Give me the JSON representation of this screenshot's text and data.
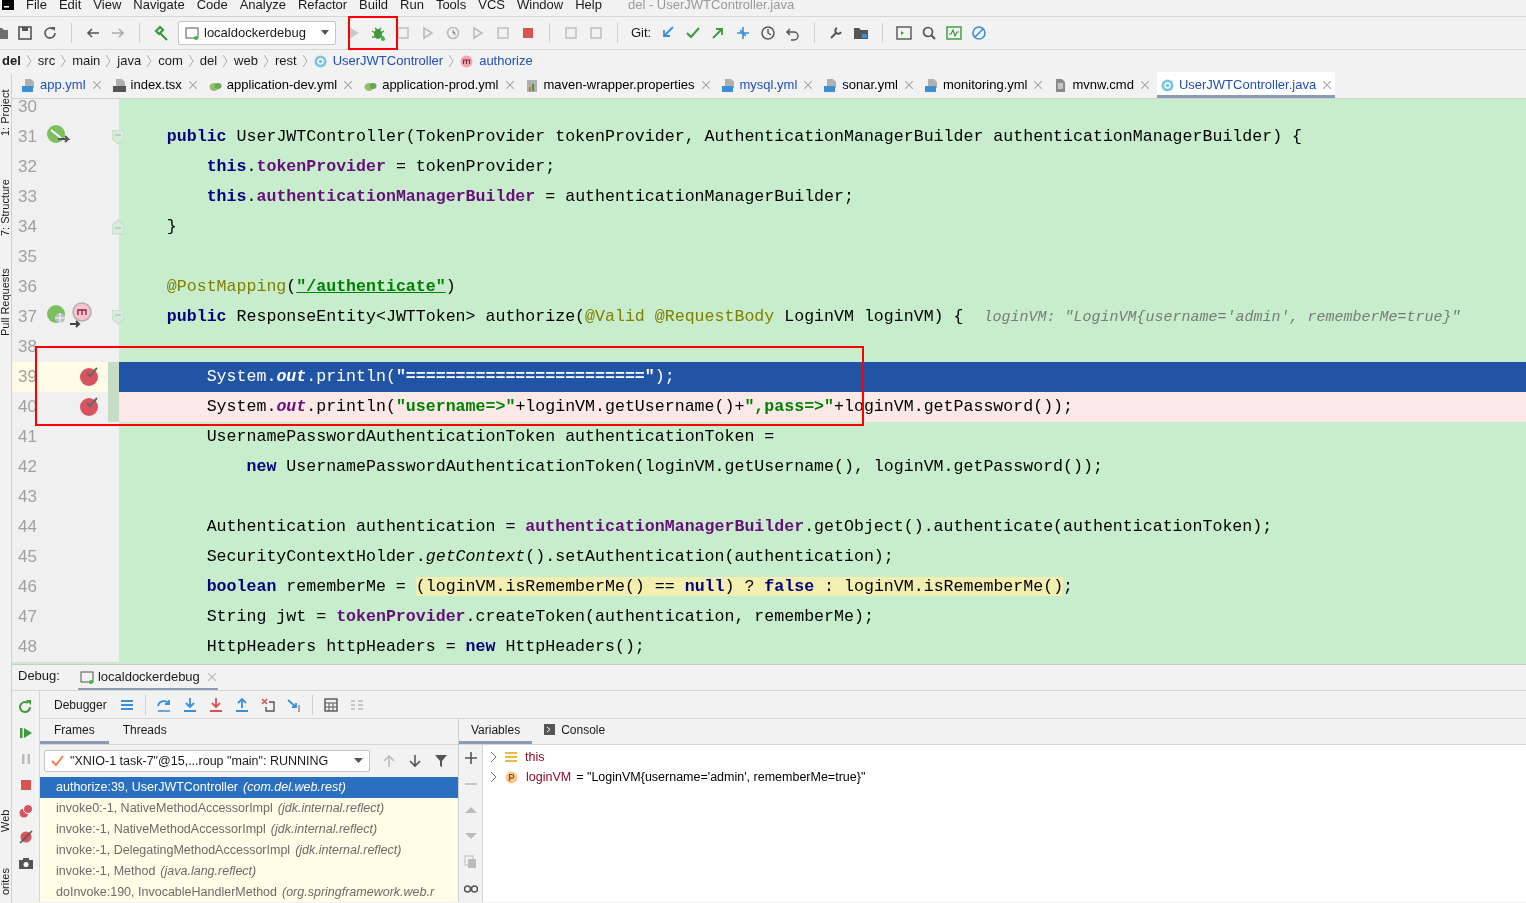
{
  "menu": [
    "File",
    "Edit",
    "View",
    "Navigate",
    "Code",
    "Analyze",
    "Refactor",
    "Build",
    "Run",
    "Tools",
    "VCS",
    "Window",
    "Help"
  ],
  "window_title": "del - UserJWTController.java",
  "toolbar": {
    "run_config": "localdockerdebug",
    "git_label": "Git:",
    "debug_outlined": true
  },
  "breadcrumbs": [
    {
      "label": "del",
      "kind": "project"
    },
    {
      "label": "src",
      "kind": "folder"
    },
    {
      "label": "main",
      "kind": "folder"
    },
    {
      "label": "java",
      "kind": "folder"
    },
    {
      "label": "com",
      "kind": "folder"
    },
    {
      "label": "del",
      "kind": "folder"
    },
    {
      "label": "web",
      "kind": "folder"
    },
    {
      "label": "rest",
      "kind": "folder"
    },
    {
      "label": "UserJWTController",
      "kind": "class"
    },
    {
      "label": "authorize",
      "kind": "method"
    }
  ],
  "tabs": [
    {
      "label": "app.yml",
      "kind": "dc",
      "modified": true,
      "selected": false
    },
    {
      "label": "index.tsx",
      "kind": "tsx",
      "modified": false,
      "selected": false
    },
    {
      "label": "application-dev.yml",
      "kind": "spring",
      "modified": false,
      "selected": false
    },
    {
      "label": "application-prod.yml",
      "kind": "spring",
      "modified": false,
      "selected": false
    },
    {
      "label": "maven-wrapper.properties",
      "kind": "props",
      "modified": false,
      "selected": false
    },
    {
      "label": "mysql.yml",
      "kind": "dc",
      "modified": true,
      "selected": false
    },
    {
      "label": "sonar.yml",
      "kind": "dc",
      "modified": false,
      "selected": false
    },
    {
      "label": "monitoring.yml",
      "kind": "dc",
      "modified": false,
      "selected": false
    },
    {
      "label": "mvnw.cmd",
      "kind": "file",
      "modified": false,
      "selected": false
    },
    {
      "label": "UserJWTController.java",
      "kind": "class",
      "modified": true,
      "selected": true
    }
  ],
  "side_tools_top": [
    "1: Project",
    "7: Structure",
    "Pull Requests"
  ],
  "side_tools_bottom": [
    "Web",
    "orites"
  ],
  "code_outlined": true,
  "lines": [
    {
      "number": "30",
      "current": false,
      "breakpoint": false
    },
    {
      "number": "31",
      "current": false,
      "breakpoint": false,
      "gutter_marker": {
        "kind": "bean"
      },
      "fold": {
        "kind": "start"
      },
      "tokens": [
        {
          "text": "    public",
          "kind": "kw"
        },
        {
          "text": " UserJWTController(TokenProvider tokenProvider, AuthenticationManagerBuilder authenticationManagerBuilder) {",
          "kind": "plain"
        }
      ]
    },
    {
      "number": "32",
      "current": false,
      "breakpoint": false,
      "tokens": [
        {
          "text": "        this",
          "kind": "kw"
        },
        {
          "text": ".",
          "kind": "plain"
        },
        {
          "text": "tokenProvider",
          "kind": "field"
        },
        {
          "text": " = tokenProvider;",
          "kind": "plain"
        }
      ]
    },
    {
      "number": "33",
      "current": false,
      "breakpoint": false,
      "tokens": [
        {
          "text": "        this",
          "kind": "kw"
        },
        {
          "text": ".",
          "kind": "plain"
        },
        {
          "text": "authenticationManagerBuilder",
          "kind": "field"
        },
        {
          "text": " = authenticationManagerBuilder;",
          "kind": "plain"
        }
      ]
    },
    {
      "number": "34",
      "current": false,
      "breakpoint": false,
      "fold": {
        "kind": "end"
      },
      "tokens": [
        {
          "text": "    }",
          "kind": "plain"
        }
      ]
    },
    {
      "number": "35",
      "current": false,
      "breakpoint": false
    },
    {
      "number": "36",
      "current": false,
      "breakpoint": false,
      "tokens": [
        {
          "text": "    @PostMapping",
          "kind": "ann"
        },
        {
          "text": "(",
          "kind": "plain"
        },
        {
          "text": "\"/authenticate\"",
          "kind": "url"
        },
        {
          "text": ")",
          "kind": "plain"
        }
      ]
    },
    {
      "number": "37",
      "current": false,
      "breakpoint": false,
      "gutter_marker": {
        "kind": "endpoint"
      },
      "fold": {
        "kind": "start"
      },
      "tokens": [
        {
          "text": "    public",
          "kind": "kw"
        },
        {
          "text": " ResponseEntity<JWTToken> authorize(",
          "kind": "plain"
        },
        {
          "text": "@Valid",
          "kind": "ann"
        },
        {
          "text": " @RequestBody",
          "kind": "ann"
        },
        {
          "text": " LoginVM loginVM) {",
          "kind": "plain"
        },
        {
          "text": "loginVM: \"LoginVM{username='admin', rememberMe=true}\"",
          "kind": "hint"
        }
      ]
    },
    {
      "number": "38",
      "current": false,
      "breakpoint": false
    },
    {
      "number": "39",
      "current": true,
      "breakpoint": true,
      "tokens": [
        {
          "text": "        System.",
          "kind": "plain"
        },
        {
          "text": "out",
          "kind": "static"
        },
        {
          "text": ".println(",
          "kind": "plain"
        },
        {
          "text": "\"========================\"",
          "kind": "str"
        },
        {
          "text": ");",
          "kind": "plain"
        }
      ]
    },
    {
      "number": "40",
      "current": false,
      "breakpoint": true,
      "tokens": [
        {
          "text": "        System.",
          "kind": "plain"
        },
        {
          "text": "out",
          "kind": "static"
        },
        {
          "text": ".println(",
          "kind": "plain"
        },
        {
          "text": "\"username=>\"",
          "kind": "str"
        },
        {
          "text": "+loginVM.getUsername()+",
          "kind": "plain"
        },
        {
          "text": "\",pass=>\"",
          "kind": "str"
        },
        {
          "text": "+loginVM.getPassword());",
          "kind": "plain"
        }
      ]
    },
    {
      "number": "41",
      "current": false,
      "breakpoint": false,
      "tokens": [
        {
          "text": "        UsernamePasswordAuthenticationToken authenticationToken =",
          "kind": "plain"
        }
      ]
    },
    {
      "number": "42",
      "current": false,
      "breakpoint": false,
      "tokens": [
        {
          "text": "            new",
          "kind": "kw"
        },
        {
          "text": " UsernamePasswordAuthenticationToken(loginVM.getUsername(), loginVM.getPassword());",
          "kind": "plain"
        }
      ]
    },
    {
      "number": "43",
      "current": false,
      "breakpoint": false
    },
    {
      "number": "44",
      "current": false,
      "breakpoint": false,
      "tokens": [
        {
          "text": "        Authentication authentication = ",
          "kind": "plain"
        },
        {
          "text": "authenticationManagerBuilder",
          "kind": "field"
        },
        {
          "text": ".getObject().authenticate(authenticationToken);",
          "kind": "plain"
        }
      ]
    },
    {
      "number": "45",
      "current": false,
      "breakpoint": false,
      "tokens": [
        {
          "text": "        SecurityContextHolder.",
          "kind": "plain"
        },
        {
          "text": "getContext",
          "kind": "italic"
        },
        {
          "text": "().setAuthentication(authentication);",
          "kind": "plain"
        }
      ]
    },
    {
      "number": "46",
      "current": false,
      "breakpoint": false,
      "tokens": [
        {
          "text": "        boolean",
          "kind": "kw"
        },
        {
          "text": " rememberMe = ",
          "kind": "plain"
        },
        {
          "text": "(loginVM.isRememberMe() == ",
          "kind": "plain",
          "matched": true
        },
        {
          "text": "null",
          "kind": "kw",
          "matched": true
        },
        {
          "text": ") ? ",
          "kind": "plain",
          "matched": true
        },
        {
          "text": "false",
          "kind": "kw",
          "matched": true
        },
        {
          "text": " : loginVM.isRememberMe()",
          "kind": "plain",
          "matched": true
        },
        {
          "text": ";",
          "kind": "plain"
        }
      ]
    },
    {
      "number": "47",
      "current": false,
      "breakpoint": false,
      "tokens": [
        {
          "text": "        String jwt = ",
          "kind": "plain"
        },
        {
          "text": "tokenProvider",
          "kind": "field"
        },
        {
          "text": ".createToken(authentication, rememberMe);",
          "kind": "plain"
        }
      ]
    },
    {
      "number": "48",
      "current": false,
      "breakpoint": false,
      "tokens": [
        {
          "text": "        HttpHeaders httpHeaders = ",
          "kind": "plain"
        },
        {
          "text": "new",
          "kind": "kw"
        },
        {
          "text": " HttpHeaders();",
          "kind": "plain"
        }
      ]
    }
  ],
  "debug": {
    "label": "Debug:",
    "session": "localdockerdebug",
    "toolbar_tab": "Debugger",
    "frame_tabs": [
      {
        "label": "Frames",
        "selected": true
      },
      {
        "label": "Threads",
        "selected": false
      }
    ],
    "thread": "\"XNIO-1 task-7\"@15,...roup \"main\": RUNNING",
    "frames": [
      {
        "method": "authorize:39, UserJWTController",
        "location": "(com.del.web.rest)",
        "selected": true
      },
      {
        "method": "invoke0:-1, NativeMethodAccessorImpl",
        "location": "(jdk.internal.reflect)",
        "selected": false
      },
      {
        "method": "invoke:-1, NativeMethodAccessorImpl",
        "location": "(jdk.internal.reflect)",
        "selected": false
      },
      {
        "method": "invoke:-1, DelegatingMethodAccessorImpl",
        "location": "(jdk.internal.reflect)",
        "selected": false
      },
      {
        "method": "invoke:-1, Method",
        "location": "(java.lang.reflect)",
        "selected": false
      },
      {
        "method": "doInvoke:190, InvocableHandlerMethod",
        "location": "(org.springframework.web.r",
        "selected": false
      }
    ],
    "var_tabs": [
      {
        "label": "Variables",
        "selected": true
      },
      {
        "label": "Console",
        "selected": false
      }
    ],
    "variables": [
      {
        "name": "this",
        "kind": "object"
      },
      {
        "name": "loginVM",
        "value": "= \"LoginVM{username='admin', rememberMe=true}\"",
        "kind": "param"
      }
    ]
  }
}
